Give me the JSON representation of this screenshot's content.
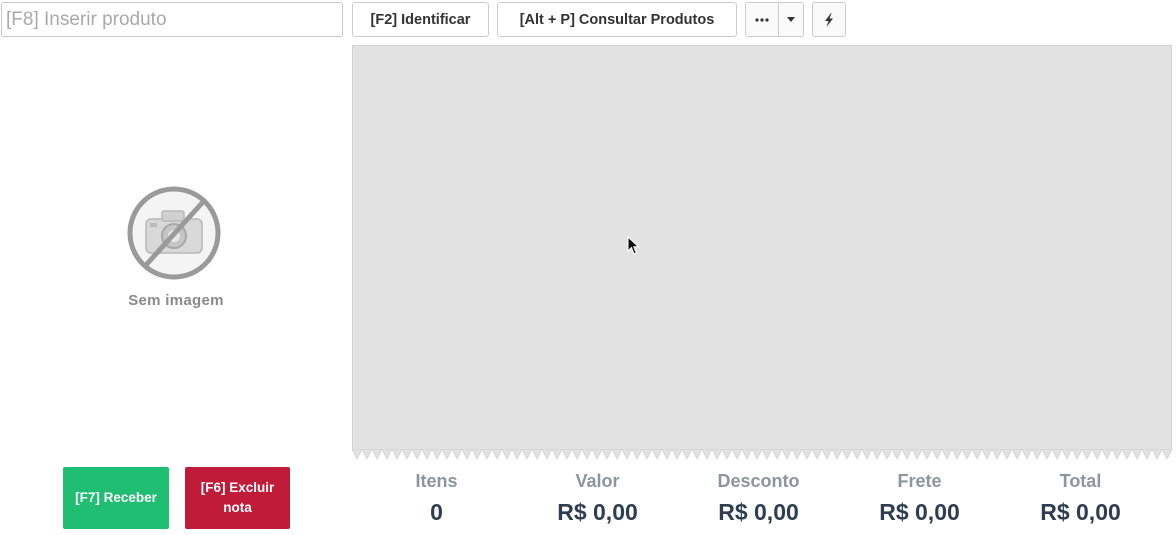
{
  "toolbar": {
    "search_placeholder": "[F8] Inserir produto",
    "identificar_label": "[F2] Identificar",
    "consultar_label": "[Alt + P] Consultar Produtos",
    "more_icon": "ellipsis-icon",
    "caret_icon": "caret-down-icon",
    "quick_icon": "bolt-icon"
  },
  "product": {
    "no_image_icon": "no-camera-icon",
    "no_image_label": "Sem imagem"
  },
  "actions": {
    "receber_label": "[F7] Receber",
    "excluir_label": "[F6] Excluir nota",
    "receber_color": "#1fbe72",
    "excluir_color": "#c01c3a"
  },
  "summary": {
    "items": [
      {
        "label": "Itens",
        "value": "0"
      },
      {
        "label": "Valor",
        "value": "R$ 0,00"
      },
      {
        "label": "Desconto",
        "value": "R$ 0,00"
      },
      {
        "label": "Frete",
        "value": "R$ 0,00"
      },
      {
        "label": "Total",
        "value": "R$ 0,00"
      }
    ]
  },
  "colors": {
    "receipt_bg": "#e1e2e1",
    "label_gray": "#8c96a0",
    "value_dark": "#2c3e50"
  }
}
